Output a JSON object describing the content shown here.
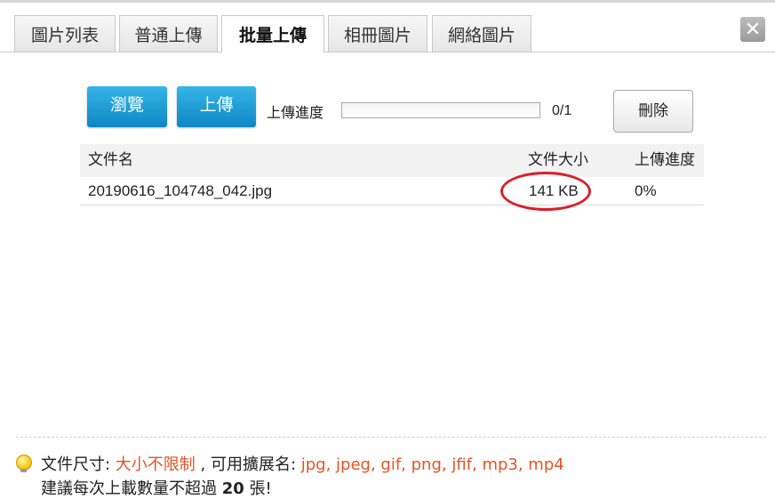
{
  "tabs": [
    {
      "label": "圖片列表",
      "active": false
    },
    {
      "label": "普通上傳",
      "active": false
    },
    {
      "label": "批量上傳",
      "active": true
    },
    {
      "label": "相冊圖片",
      "active": false
    },
    {
      "label": "網絡圖片",
      "active": false
    }
  ],
  "close": {
    "label": "✕",
    "icon": "close-icon"
  },
  "toolbar": {
    "browse_label": "瀏覽",
    "upload_label": "上傳",
    "progress_label": "上傳進度",
    "progress_count": "0/1",
    "progress_fraction": 0,
    "delete_label": "刪除"
  },
  "table": {
    "headers": {
      "name": "文件名",
      "size": "文件大小",
      "progress": "上傳進度"
    },
    "rows": [
      {
        "name": "20190616_104748_042.jpg",
        "size": "141 KB",
        "progress": "0%"
      }
    ]
  },
  "info": {
    "icon": "lightbulb-icon",
    "size_prefix": "文件尺寸: ",
    "size_value": "大小不限制",
    "ext_prefix": " , 可用擴展名: ",
    "ext_value": "jpg, jpeg, gif, png, jfif, mp3, mp4",
    "line2_prefix": "建議每次上載數量不超過 ",
    "line2_count": "20",
    "line2_suffix": " 張!"
  },
  "colors": {
    "accent_blue": "#1a9ad6",
    "highlight_orange": "#e0552a",
    "annotation_red": "#d8202b"
  }
}
